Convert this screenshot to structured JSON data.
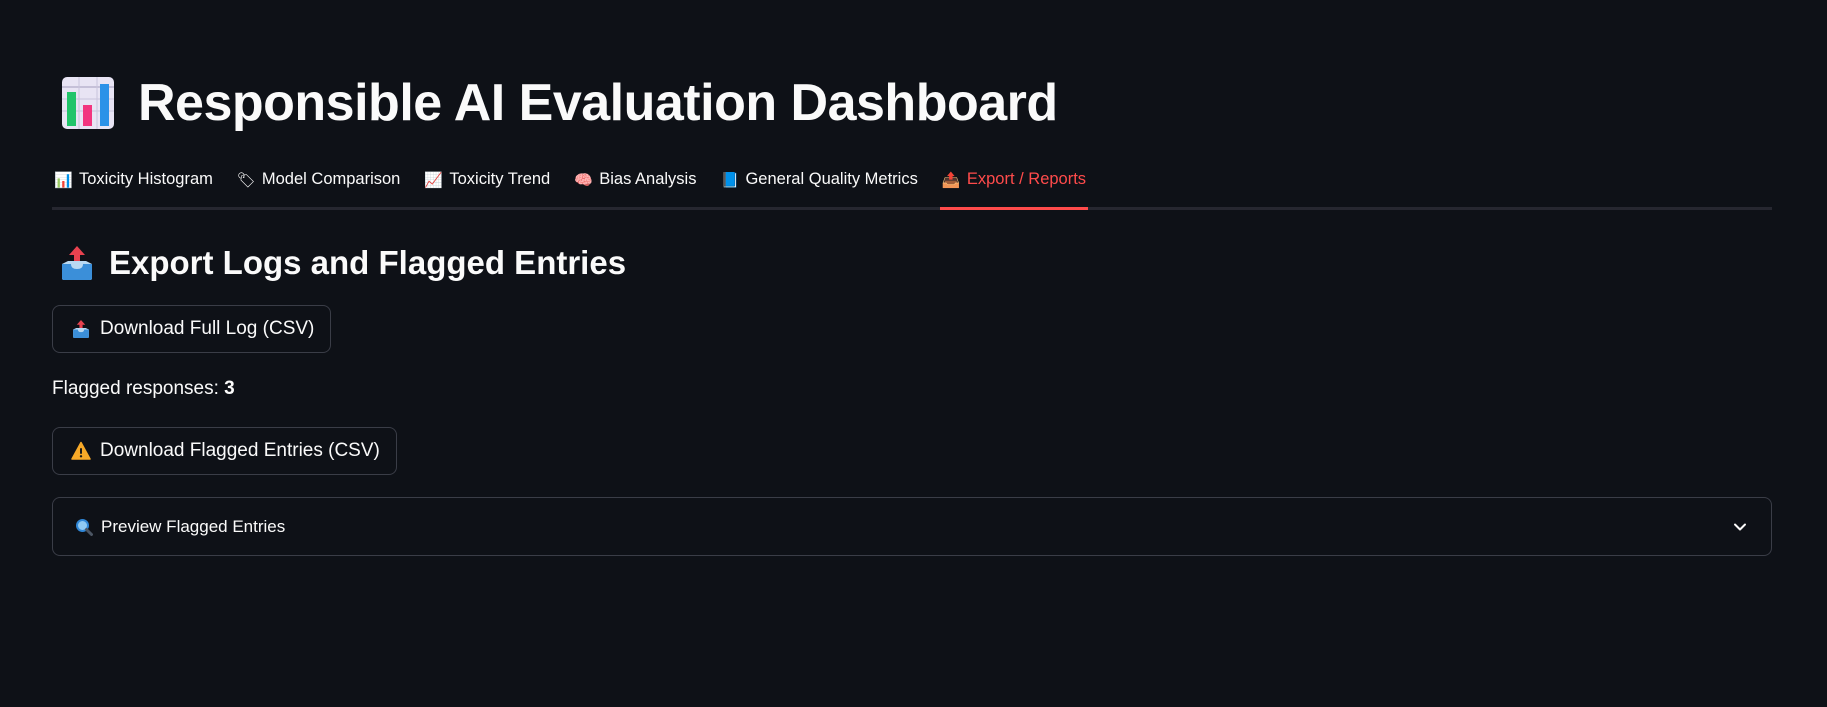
{
  "header": {
    "title": "Responsible AI Evaluation Dashboard",
    "title_icon": "bar-chart-icon"
  },
  "tabs": [
    {
      "label": "Toxicity Histogram",
      "icon": "📊",
      "active": false
    },
    {
      "label": "Model Comparison",
      "icon": "🏷",
      "active": false
    },
    {
      "label": "Toxicity Trend",
      "icon": "📈",
      "active": false
    },
    {
      "label": "Bias Analysis",
      "icon": "🧠",
      "active": false
    },
    {
      "label": "General Quality Metrics",
      "icon": "📘",
      "active": false
    },
    {
      "label": "Export / Reports",
      "icon": "📤",
      "active": true
    }
  ],
  "section": {
    "heading": "Export Logs and Flagged Entries",
    "icon": "outbox-tray-icon"
  },
  "buttons": {
    "download_log": "Download Full Log (CSV)",
    "download_flagged": "Download Flagged Entries (CSV)"
  },
  "flagged": {
    "label": "Flagged responses: ",
    "count": "3"
  },
  "expander": {
    "label": "Preview Flagged Entries",
    "icon": "magnifier-icon",
    "state": "collapsed"
  },
  "colors": {
    "background": "#0e1117",
    "text": "#fafafa",
    "accent": "#ff4b4b",
    "border": "#3a3d47"
  }
}
